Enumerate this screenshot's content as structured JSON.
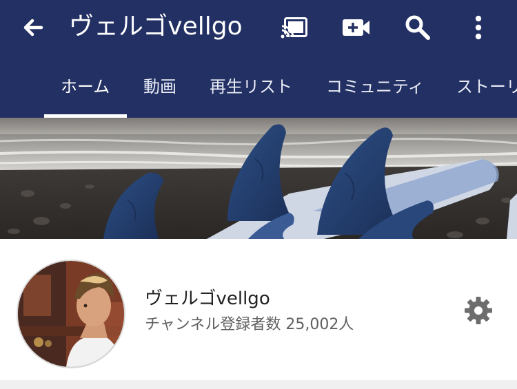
{
  "header": {
    "title": "ヴェルゴvellgo",
    "background_color": "#233063",
    "icons": [
      "back-arrow-icon",
      "cast-icon",
      "video-camera-add-icon",
      "search-icon",
      "more-vert-icon"
    ]
  },
  "tabs": [
    {
      "label": "ホーム",
      "active": true
    },
    {
      "label": "動画",
      "active": false
    },
    {
      "label": "再生リスト",
      "active": false
    },
    {
      "label": "コミュニティ",
      "active": false
    },
    {
      "label": "ストーリ",
      "active": false
    }
  ],
  "channel": {
    "name": "ヴェルゴvellgo",
    "subscribers": "チャンネル登録者数 25,002人"
  }
}
